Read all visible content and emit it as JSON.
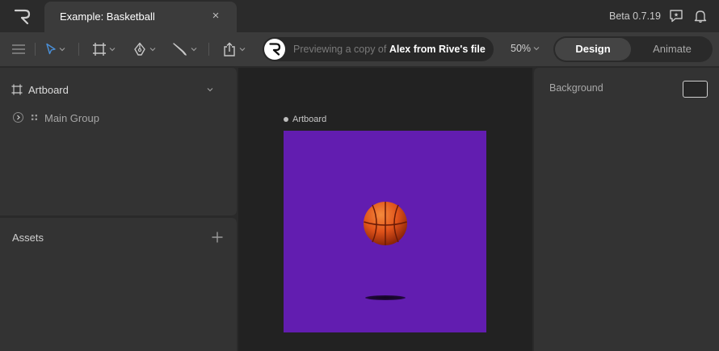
{
  "tab": {
    "title": "Example: Basketball",
    "close": "×"
  },
  "version": "Beta 0.7.19",
  "toolbar": {
    "preview_prefix": "Previewing a copy of ",
    "preview_owner": "Alex from Rive's file",
    "zoom": "50%",
    "modes": {
      "design": "Design",
      "animate": "Animate"
    }
  },
  "hierarchy": {
    "artboard": "Artboard",
    "group": "Main Group"
  },
  "assets": {
    "title": "Assets"
  },
  "canvas": {
    "artboard_label": "Artboard",
    "artboard_color": "#621db0"
  },
  "inspector": {
    "background_label": "Background"
  },
  "icons": [
    "rive-logo-icon",
    "close-icon",
    "feedback-icon",
    "bell-icon",
    "menu-icon",
    "select-tool-icon",
    "artboard-tool-icon",
    "pen-tool-icon",
    "brush-tool-icon",
    "export-icon",
    "chevron-down-icon",
    "plus-icon",
    "basketball-icon"
  ],
  "colors": {
    "accent": "#4a90d9",
    "artboard": "#621db0",
    "ball": "#e0531a"
  }
}
